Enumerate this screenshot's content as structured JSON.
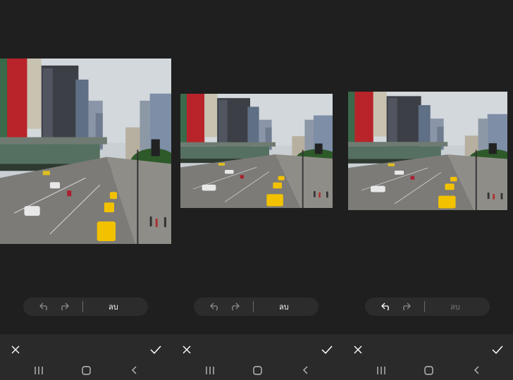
{
  "panels": [
    {
      "toolbar": {
        "undo_icon": "undo-icon",
        "redo_icon": "redo-icon",
        "erase_label": "ลบ",
        "erase_enabled": true,
        "undo_enabled": false
      }
    },
    {
      "toolbar": {
        "undo_icon": "undo-icon",
        "redo_icon": "redo-icon",
        "erase_label": "ลบ",
        "erase_enabled": true,
        "undo_enabled": false
      }
    },
    {
      "toolbar": {
        "undo_icon": "undo-icon",
        "redo_icon": "redo-icon",
        "erase_label": "ลบ",
        "erase_enabled": false,
        "undo_enabled": true
      }
    }
  ],
  "bottom_bar": {
    "close_icon": "close-icon",
    "confirm_icon": "check-icon"
  },
  "nav_bar": {
    "recents_icon": "recents-icon",
    "home_icon": "home-icon",
    "back_icon": "back-icon"
  },
  "colors": {
    "background": "#1f1f1f",
    "toolbar": "#2c2c2c",
    "bottom_bar": "#2a2a2a",
    "taxi_yellow": "#f2c200"
  }
}
